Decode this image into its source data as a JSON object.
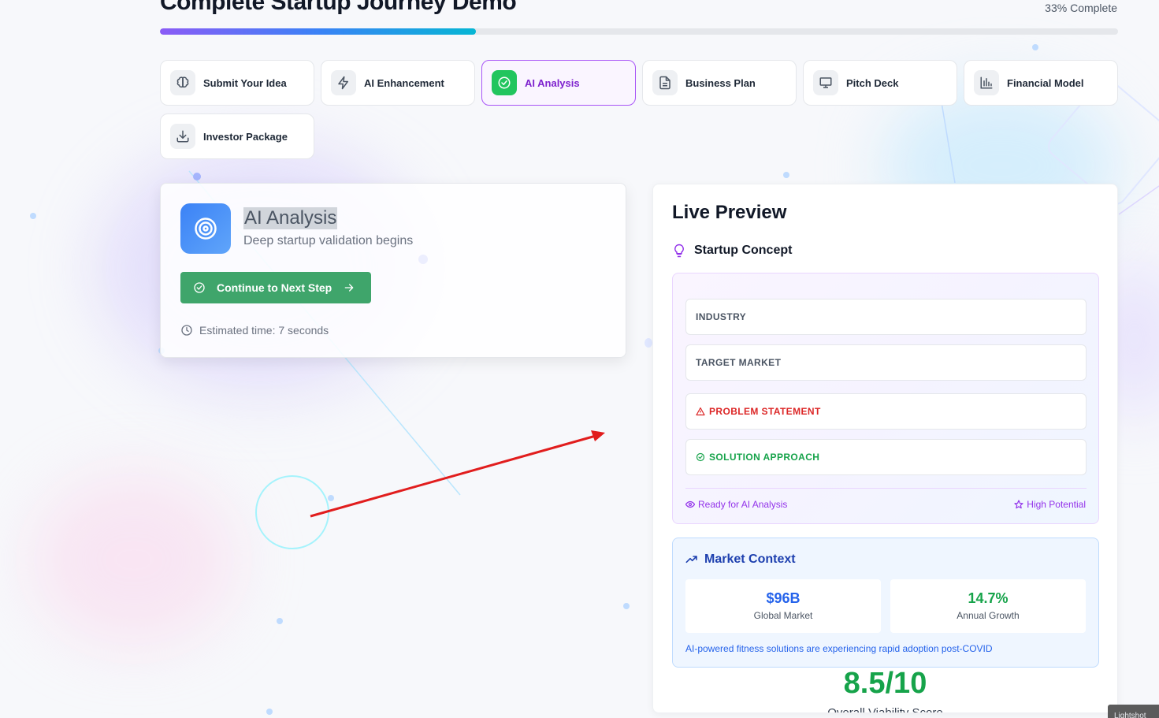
{
  "header": {
    "title": "Complete Startup Journey Demo",
    "progress_label": "33% Complete",
    "progress_value": 0.33
  },
  "steps": [
    {
      "label": "Submit Your Idea",
      "icon": "brain-icon",
      "active": false
    },
    {
      "label": "AI Enhancement",
      "icon": "lightning-icon",
      "active": false
    },
    {
      "label": "AI Analysis",
      "icon": "check-circle-icon",
      "active": true
    },
    {
      "label": "Business Plan",
      "icon": "document-icon",
      "active": false
    },
    {
      "label": "Pitch Deck",
      "icon": "presentation-icon",
      "active": false
    },
    {
      "label": "Financial Model",
      "icon": "bar-chart-icon",
      "active": false
    },
    {
      "label": "Investor Package",
      "icon": "download-icon",
      "active": false
    }
  ],
  "analysis": {
    "title": "AI Analysis",
    "subtitle": "Deep startup validation begins",
    "continue_label": "Continue to Next Step",
    "estimated_time": "Estimated time: 7 seconds",
    "icon": "target-icon"
  },
  "preview": {
    "title": "Live Preview",
    "concept": {
      "heading": "Startup Concept",
      "industry": "INDUSTRY",
      "target_market": "TARGET MARKET",
      "problem": "PROBLEM STATEMENT",
      "solution": "SOLUTION APPROACH",
      "status_left": "Ready for AI Analysis",
      "status_right": "High Potential"
    },
    "market": {
      "heading": "Market Context",
      "global_value": "$96B",
      "global_label": "Global Market",
      "growth_value": "14.7%",
      "growth_label": "Annual Growth",
      "note": "AI-powered fitness solutions are experiencing rapid adoption post-COVID"
    },
    "score": {
      "value": "8.5/10",
      "label": "Overall Viability Score"
    }
  },
  "overlay": {
    "lightshot_label": "Lightshot"
  },
  "colors": {
    "accent_purple": "#a855f7",
    "accent_green": "#3fa56b",
    "accent_blue": "#3b82f6",
    "danger": "#dc2626",
    "success": "#16a34a"
  }
}
